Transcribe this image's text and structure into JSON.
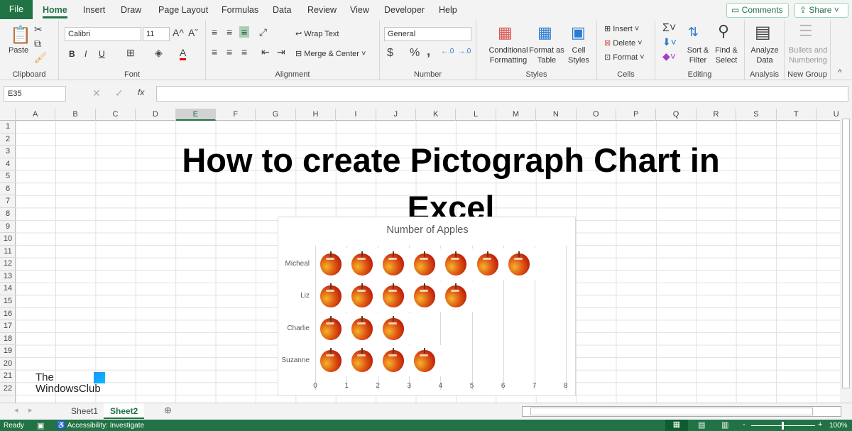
{
  "tabs": [
    "File",
    "Home",
    "Insert",
    "Draw",
    "Page Layout",
    "Formulas",
    "Data",
    "Review",
    "View",
    "Developer",
    "Help"
  ],
  "top_buttons": {
    "comments": "Comments",
    "share": "Share"
  },
  "ribbon": {
    "clipboard": {
      "label": "Clipboard",
      "paste": "Paste"
    },
    "font": {
      "label": "Font",
      "name": "Calibri",
      "size": "11",
      "bold": "B",
      "italic": "I",
      "underline": "U"
    },
    "alignment": {
      "label": "Alignment",
      "wrap": "Wrap Text",
      "merge": "Merge & Center"
    },
    "number": {
      "label": "Number",
      "format": "General",
      "currency": "$",
      "percent": "%",
      "comma": ","
    },
    "styles": {
      "label": "Styles",
      "conditional": "Conditional Formatting",
      "format_table": "Format as Table",
      "cell_styles": "Cell Styles"
    },
    "cells": {
      "label": "Cells",
      "insert": "Insert",
      "delete": "Delete",
      "format": "Format"
    },
    "editing": {
      "label": "Editing",
      "sort": "Sort & Filter",
      "find": "Find & Select"
    },
    "analysis": {
      "label": "Analysis",
      "analyze": "Analyze Data"
    },
    "newgroup": {
      "label": "New Group",
      "bullets": "Bullets and Numbering"
    }
  },
  "formula_bar": {
    "name_box": "E35",
    "fx": "fx",
    "value": ""
  },
  "columns": [
    "A",
    "B",
    "C",
    "D",
    "E",
    "F",
    "G",
    "H",
    "I",
    "J",
    "K",
    "L",
    "M",
    "N",
    "O",
    "P",
    "Q",
    "R",
    "S",
    "T",
    "U"
  ],
  "rows": [
    "1",
    "2",
    "3",
    "4",
    "5",
    "6",
    "7",
    "8",
    "9",
    "10",
    "11",
    "12",
    "13",
    "14",
    "15",
    "16",
    "17",
    "18",
    "19",
    "20",
    "21",
    "22"
  ],
  "headline": {
    "line1": "How to create Pictograph Chart in",
    "line2": "Excel"
  },
  "chart_data": {
    "type": "bar",
    "title": "Number of Apples",
    "categories": [
      "Micheal",
      "Liz",
      "Charlie",
      "Suzanne"
    ],
    "values": [
      7,
      5,
      3,
      4
    ],
    "xlim": [
      0,
      8
    ],
    "xticks": [
      "0",
      "1",
      "2",
      "3",
      "4",
      "5",
      "6",
      "7",
      "8"
    ],
    "grid": true,
    "marker": "apple-icon"
  },
  "watermark": {
    "line1": "The",
    "line2": "WindowsClub"
  },
  "sheets": [
    "Sheet1",
    "Sheet2"
  ],
  "active_sheet": "Sheet2",
  "status": {
    "ready": "Ready",
    "accessibility": "Accessibility: Investigate",
    "zoom": "100%"
  },
  "colors": {
    "accent": "#217346"
  }
}
